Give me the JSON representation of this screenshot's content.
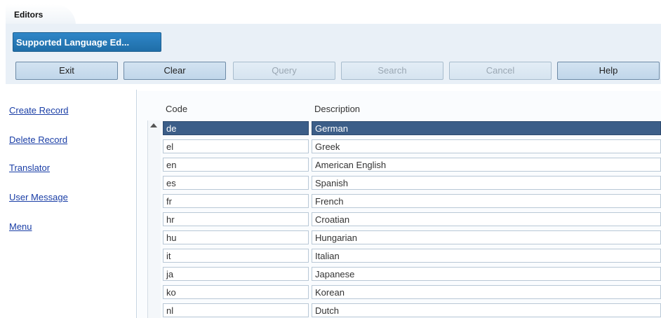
{
  "tabs": {
    "main": "Editors",
    "sub": "Supported Language Ed..."
  },
  "toolbar": {
    "exit": "Exit",
    "clear": "Clear",
    "query": "Query",
    "search": "Search",
    "cancel": "Cancel",
    "help": "Help"
  },
  "nav": {
    "create_record": "Create Record",
    "delete_record": "Delete Record",
    "translator": "Translator",
    "user_message": "User Message",
    "menu": "Menu"
  },
  "grid": {
    "headers": {
      "code": "Code",
      "description": "Description"
    },
    "rows": [
      {
        "code": "de",
        "description": "German"
      },
      {
        "code": "el",
        "description": "Greek"
      },
      {
        "code": "en",
        "description": "American English"
      },
      {
        "code": "es",
        "description": "Spanish"
      },
      {
        "code": "fr",
        "description": "French"
      },
      {
        "code": "hr",
        "description": "Croatian"
      },
      {
        "code": "hu",
        "description": "Hungarian"
      },
      {
        "code": "it",
        "description": "Italian"
      },
      {
        "code": "ja",
        "description": "Japanese"
      },
      {
        "code": "ko",
        "description": "Korean"
      },
      {
        "code": "nl",
        "description": "Dutch"
      }
    ]
  }
}
